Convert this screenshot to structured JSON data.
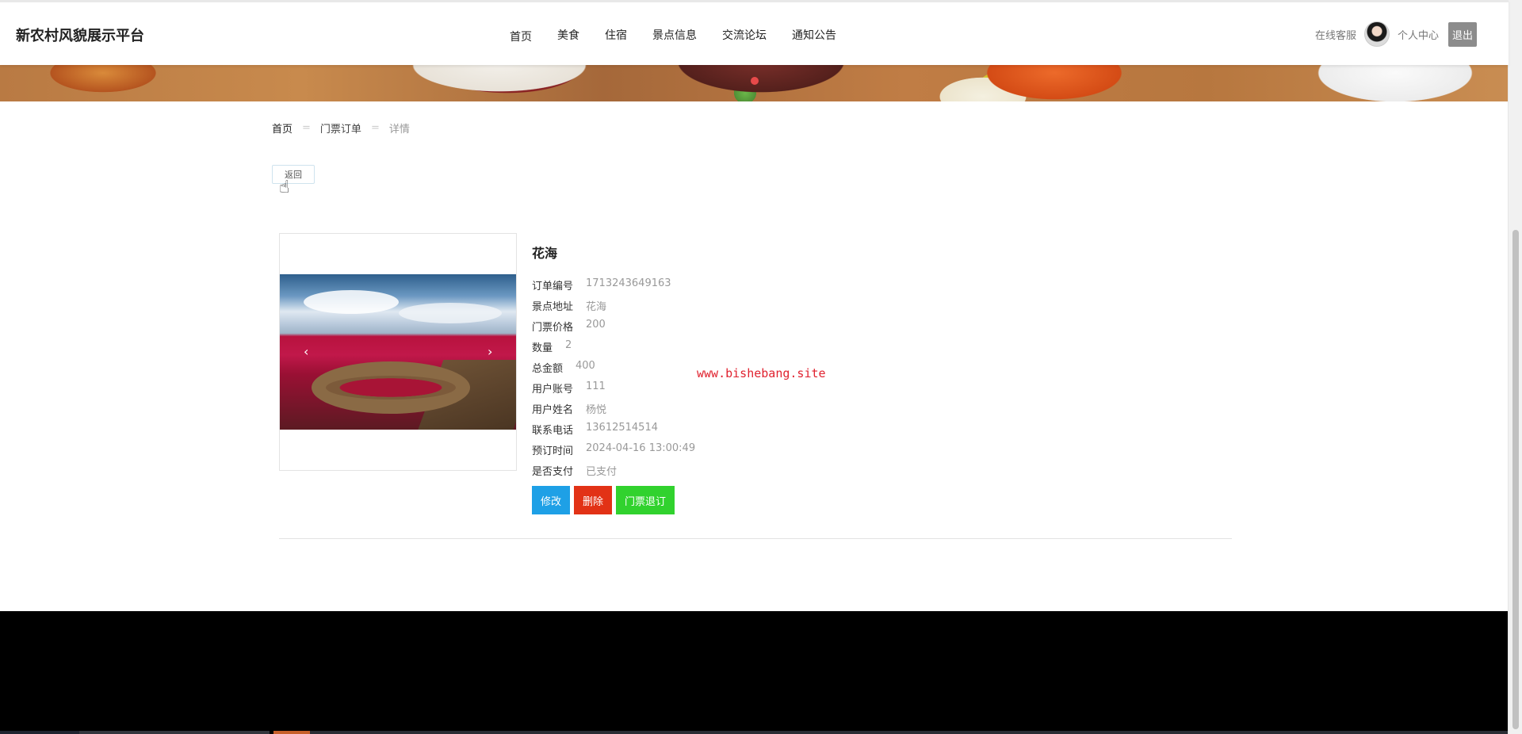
{
  "header": {
    "brand": "新农村风貌展示平台",
    "nav": [
      "首页",
      "美食",
      "住宿",
      "景点信息",
      "交流论坛",
      "通知公告"
    ],
    "online_service": "在线客服",
    "personal_center": "个人中心",
    "logout": "退出"
  },
  "breadcrumb": {
    "home": "首页",
    "section": "门票订单",
    "current": "详情",
    "separator": "="
  },
  "back_button": "返回",
  "carousel": {
    "prev": "‹",
    "next": "›"
  },
  "detail": {
    "title": "花海",
    "fields": [
      {
        "label": "订单编号",
        "value": "1713243649163"
      },
      {
        "label": "景点地址",
        "value": "花海"
      },
      {
        "label": "门票价格",
        "value": "200"
      },
      {
        "label": "数量",
        "value": "2"
      },
      {
        "label": "总金额",
        "value": "400"
      },
      {
        "label": "用户账号",
        "value": "111"
      },
      {
        "label": "用户姓名",
        "value": "杨悦"
      },
      {
        "label": "联系电话",
        "value": "13612514514"
      },
      {
        "label": "预订时间",
        "value": "2024-04-16 13:00:49"
      },
      {
        "label": "是否支付",
        "value": "已支付"
      }
    ]
  },
  "actions": {
    "edit": "修改",
    "delete": "删除",
    "refund": "门票退订"
  },
  "watermark": "www.bishebang.site",
  "colors": {
    "edit": "#1ea0e6",
    "delete": "#e23216",
    "refund": "#31d22e",
    "watermark": "#e0222f",
    "logout_bg": "#8c8c8c"
  }
}
